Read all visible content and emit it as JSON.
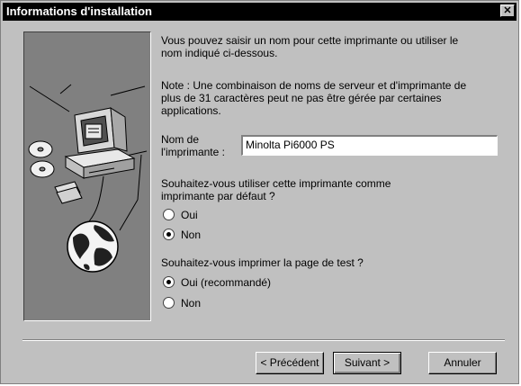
{
  "window": {
    "title": "Informations d'installation",
    "close_glyph": "✕"
  },
  "content": {
    "intro_lines": [
      "Vous pouvez saisir un nom pour cette imprimante ou utiliser le",
      "nom indiqué ci-dessous."
    ],
    "note_lines": [
      "Note : Une combinaison de noms de serveur et d'imprimante de",
      "plus de 31 caractères peut ne pas être gérée par certaines",
      "applications."
    ],
    "printer_name_label_1": "Nom de",
    "printer_name_label_2": "l'imprimante :",
    "printer_name_value": "Minolta Pi6000 PS",
    "default_question_lines": [
      "Souhaitez-vous utiliser cette imprimante comme",
      "imprimante par défaut ?"
    ],
    "default_options": [
      {
        "label": "Oui",
        "selected": false
      },
      {
        "label": "Non",
        "selected": true
      }
    ],
    "testpage_question": "Souhaitez-vous imprimer la page de test ?",
    "testpage_options": [
      {
        "label": "Oui (recommandé)",
        "selected": true
      },
      {
        "label": "Non",
        "selected": false
      }
    ]
  },
  "buttons": {
    "back": "< Précédent",
    "next": "Suivant >",
    "cancel": "Annuler"
  },
  "colors": {
    "dialog_bg": "#c0c0c0",
    "titlebar_bg": "#000000",
    "panel_bg": "#808080"
  },
  "icons": [
    "computer-with-cds-illustration",
    "globe-illustration",
    "close-icon"
  ]
}
